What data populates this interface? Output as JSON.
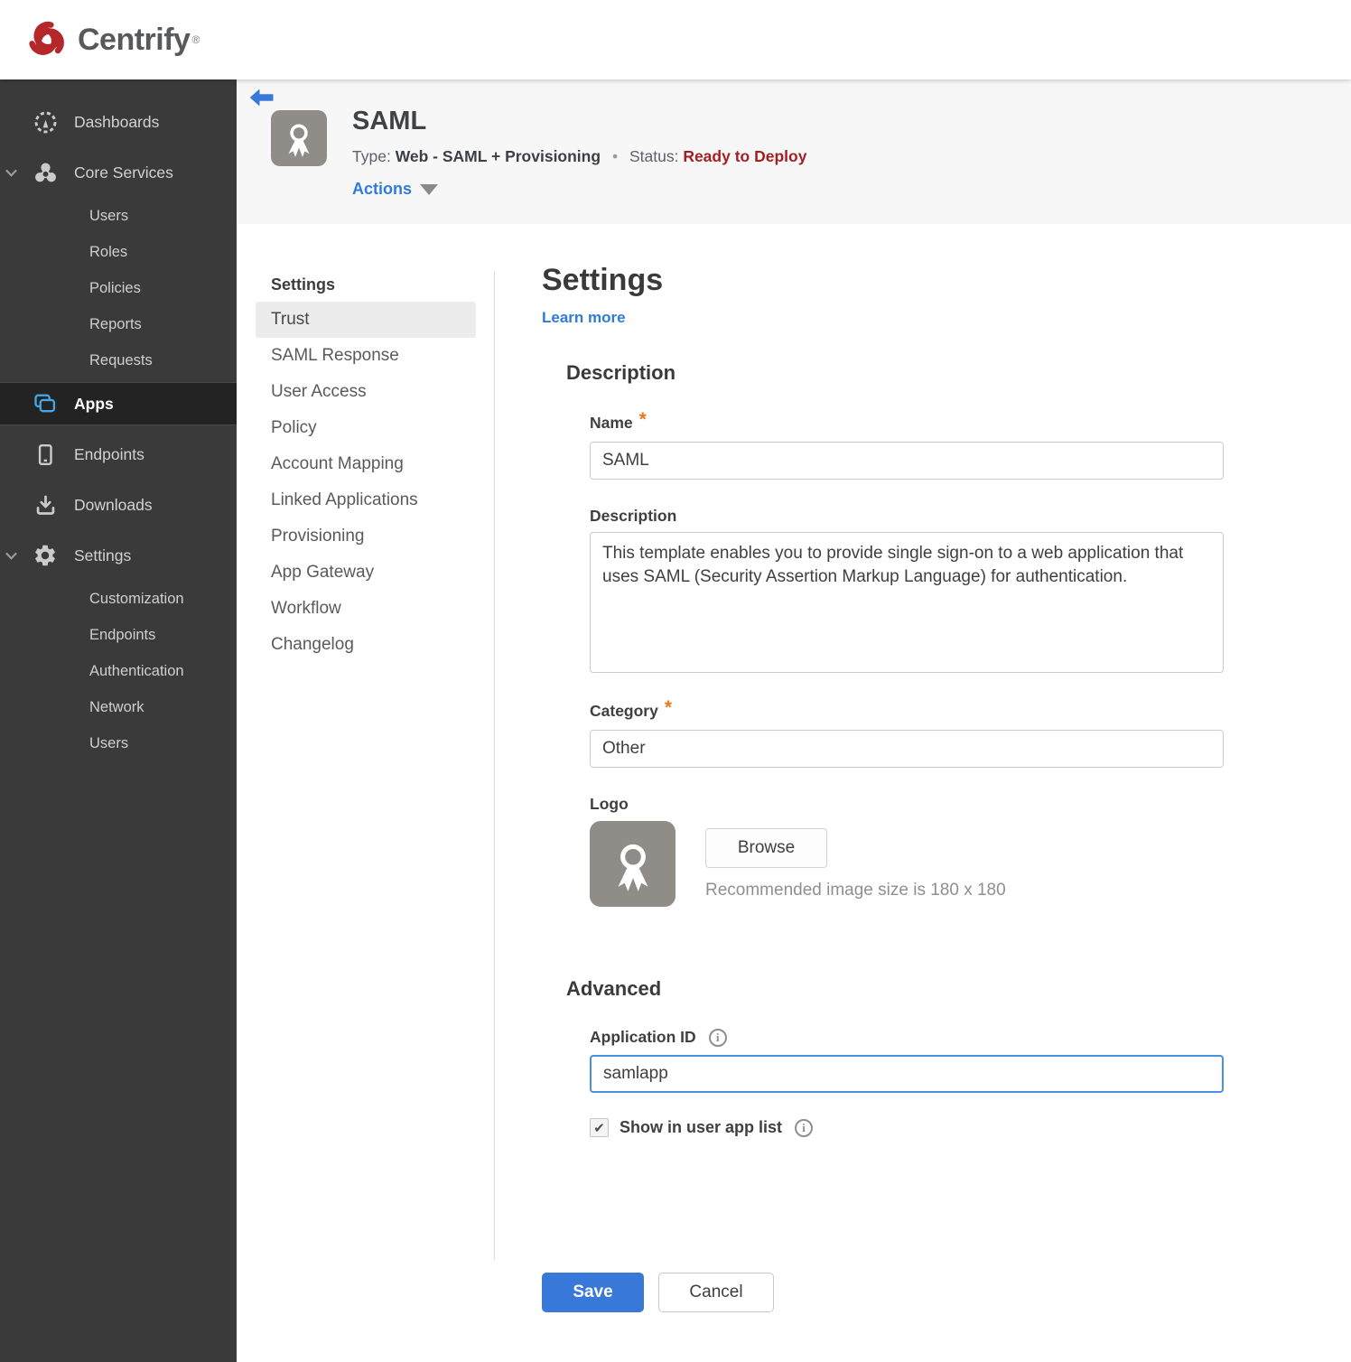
{
  "brand": {
    "name": "Centrify",
    "trademark": "®",
    "logo_color": "#b5282a"
  },
  "sidebar": {
    "items": [
      {
        "label": "Dashboards",
        "icon": "gauge-icon",
        "level": 1
      },
      {
        "label": "Core Services",
        "icon": "core-services-icon",
        "level": 1,
        "expanded": true
      },
      {
        "label": "Users",
        "level": 2
      },
      {
        "label": "Roles",
        "level": 2
      },
      {
        "label": "Policies",
        "level": 2
      },
      {
        "label": "Reports",
        "level": 2
      },
      {
        "label": "Requests",
        "level": 2
      },
      {
        "label": "Apps",
        "icon": "apps-icon",
        "level": 1,
        "active": true
      },
      {
        "label": "Endpoints",
        "icon": "tablet-icon",
        "level": 1
      },
      {
        "label": "Downloads",
        "icon": "download-icon",
        "level": 1
      },
      {
        "label": "Settings",
        "icon": "gear-icon",
        "level": 1,
        "expanded": true
      },
      {
        "label": "Customization",
        "level": 2
      },
      {
        "label": "Endpoints",
        "level": 2
      },
      {
        "label": "Authentication",
        "level": 2
      },
      {
        "label": "Network",
        "level": 2
      },
      {
        "label": "Users",
        "level": 2
      }
    ],
    "active_item": "Apps",
    "colors": {
      "background": "#3a3a3a",
      "active_background": "#232323",
      "apps_icon_blue": "#45a6e6"
    }
  },
  "header": {
    "title": "SAML",
    "type_label": "Type:",
    "type_value": "Web - SAML + Provisioning",
    "separator": "•",
    "status_label": "Status:",
    "status_value": "Ready to Deploy",
    "status_color": "#a31f24",
    "actions_label": "Actions",
    "app_icon": "award-ribbon-icon"
  },
  "subnav": {
    "header": "Settings",
    "selected": "Trust",
    "items": [
      "Trust",
      "SAML Response",
      "User Access",
      "Policy",
      "Account Mapping",
      "Linked Applications",
      "Provisioning",
      "App Gateway",
      "Workflow",
      "Changelog"
    ]
  },
  "main": {
    "title": "Settings",
    "learn_more": "Learn more",
    "sections": {
      "description": "Description",
      "advanced": "Advanced"
    },
    "form": {
      "required_mark": "*",
      "name": {
        "label": "Name",
        "value": "SAML",
        "required": true
      },
      "description": {
        "label": "Description",
        "value": "This template enables you to provide single sign-on to a web application that uses SAML (Security Assertion Markup Language) for authentication."
      },
      "category": {
        "label": "Category",
        "value": "Other",
        "required": true
      },
      "logo": {
        "label": "Logo",
        "browse_label": "Browse",
        "hint": "Recommended image size is 180 x 180",
        "icon": "award-ribbon-icon"
      },
      "application_id": {
        "label": "Application ID",
        "value": "samlapp",
        "focused": true
      },
      "show_in_user_app_list": {
        "label": "Show in user app list",
        "checked": true
      }
    },
    "buttons": {
      "save": "Save",
      "cancel": "Cancel"
    },
    "colors": {
      "accent_blue": "#2e7bd9",
      "save_blue": "#3878d8",
      "required_orange": "#e8791e",
      "focus_border": "#4a90e2"
    }
  }
}
